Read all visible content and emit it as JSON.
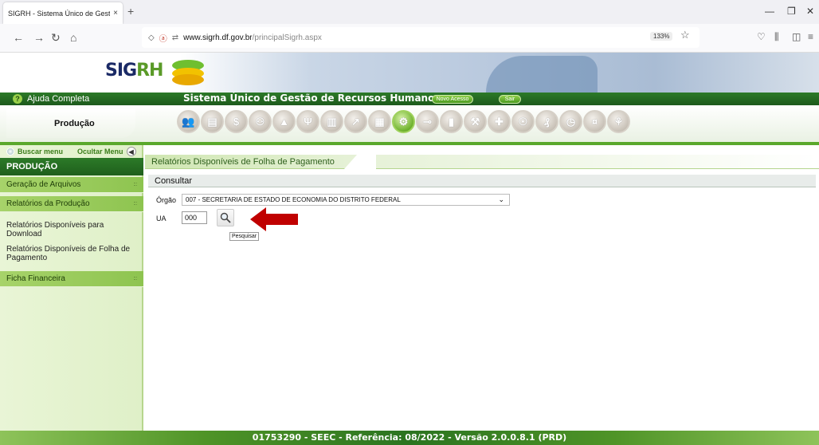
{
  "browser": {
    "tab_title": "SIGRH - Sistema Único de Gestão de",
    "tab_close": "×",
    "new_tab": "+",
    "url_domain": "www.sigrh.df.gov.br",
    "url_path": "/principalSigrh.aspx",
    "zoom": "133%"
  },
  "header": {
    "logo_sig": "SIG",
    "logo_rh": "RH",
    "help_label": "Ajuda Completa",
    "system_title": "Sistema Único de Gestão de Recursos Humanos",
    "new_access": "Novo Acesso",
    "exit": "Sair",
    "module": "Produção",
    "colors": {
      "green_dark": "#1d5a1c",
      "green_light": "#8ec450"
    }
  },
  "icon_bar": {
    "icons": [
      "people-icon",
      "document-icon",
      "dollar-icon",
      "family-icon",
      "graduation-icon",
      "food-icon",
      "clipboard-icon",
      "chart-icon",
      "calendar-icon",
      "gear-icon",
      "key-icon",
      "book-icon",
      "tools-icon",
      "medical-icon",
      "award-icon",
      "finance-icon",
      "clock-icon",
      "money-icon",
      "handshake-icon"
    ],
    "active_index": 9
  },
  "sidebar": {
    "search_menu": "Buscar menu",
    "hide_menu": "Ocultar Menu",
    "title": "PRODUÇÃO",
    "items": [
      {
        "label": "Geração de Arquivos"
      },
      {
        "label": "Relatórios da Produção"
      },
      {
        "label": "Ficha Financeira"
      }
    ],
    "subitems": [
      {
        "label": "Relatórios Disponíveis para Download"
      },
      {
        "label": "Relatórios Disponíveis de Folha de Pagamento"
      }
    ]
  },
  "main": {
    "breadcrumb": "Relatórios Disponíveis de Folha de Pagamento",
    "section": "Consultar",
    "orgao_label": "Órgão",
    "orgao_value": "007 - SECRETARIA DE ESTADO DE ECONOMIA DO DISTRITO FEDERAL",
    "ua_label": "UA",
    "ua_value": "000",
    "search_tooltip": "Pesquisar"
  },
  "footer": {
    "text": "01753290 - SEEC - Referência: 08/2022 - Versão 2.0.0.8.1 (PRD)"
  }
}
